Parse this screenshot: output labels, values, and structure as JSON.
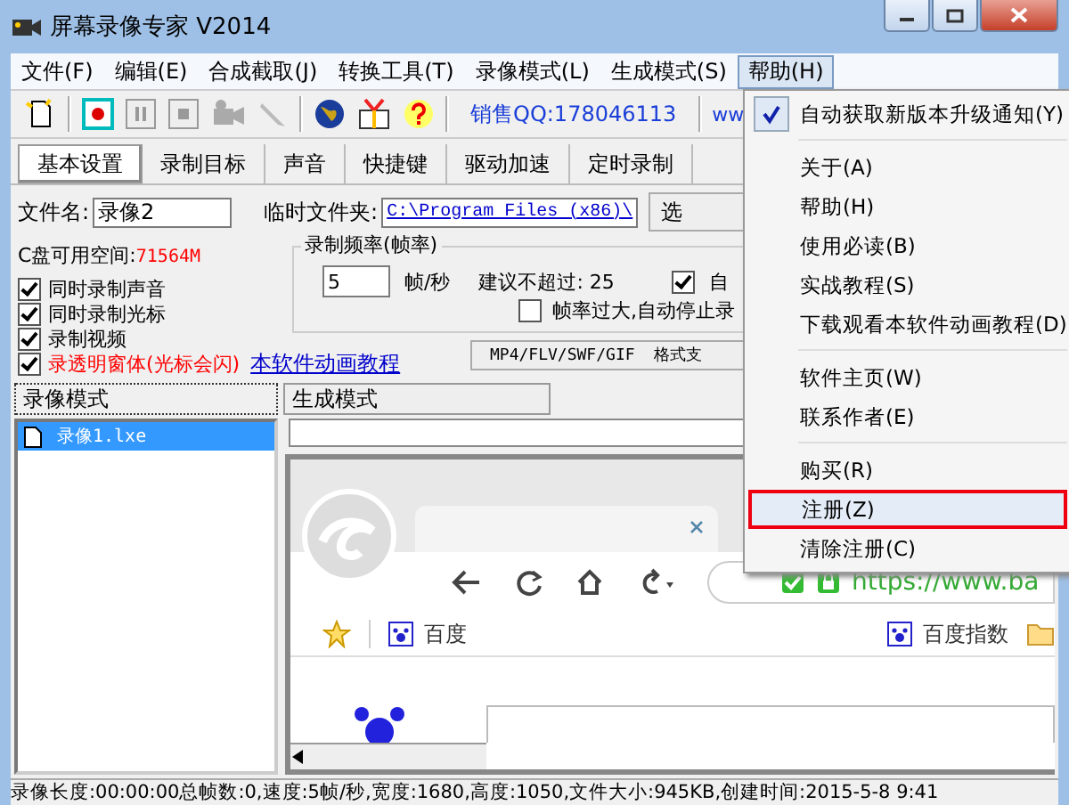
{
  "window": {
    "title": "屏幕录像专家 V2014"
  },
  "menu_bar": [
    {
      "label": "文件(F)",
      "selected": false
    },
    {
      "label": "编辑(E)",
      "selected": false
    },
    {
      "label": "合成截取(J)",
      "selected": false
    },
    {
      "label": "转换工具(T)",
      "selected": false
    },
    {
      "label": "录像模式(L)",
      "selected": false
    },
    {
      "label": "生成模式(S)",
      "selected": false
    },
    {
      "label": "帮助(H)",
      "selected": true
    }
  ],
  "toolbar": {
    "sales_qq": "销售QQ:178046113",
    "website": "ww"
  },
  "tabs": [
    {
      "label": "基本设置",
      "selected": true
    },
    {
      "label": "录制目标",
      "selected": false
    },
    {
      "label": "声音",
      "selected": false
    },
    {
      "label": "快捷键",
      "selected": false
    },
    {
      "label": "驱动加速",
      "selected": false
    },
    {
      "label": "定时录制",
      "selected": false
    }
  ],
  "settings": {
    "file_name_label": "文件名:",
    "file_name": "录像2",
    "temp_folder_label": "临时文件夹:",
    "temp_folder": "C:\\Program Files (x86)\\",
    "browse_button": "选",
    "disk_space_label": "C盘可用空间:",
    "disk_space": "71564M",
    "options": [
      {
        "label": "同时录制声音",
        "checked": true,
        "kind": "normal"
      },
      {
        "label": "同时录制光标",
        "checked": true,
        "kind": "normal"
      },
      {
        "label": "录制视频",
        "checked": true,
        "kind": "normal"
      },
      {
        "label": "录透明窗体(光标会闪)",
        "checked": true,
        "kind": "warning"
      }
    ],
    "tutorial_link": "本软件动画教程",
    "format_button": "MP4/FLV/SWF/GIF  格式支"
  },
  "frame_rate": {
    "title": "录制频率(帧率)",
    "value": "5",
    "unit": "帧/秒",
    "hint": "建议不超过: 25",
    "auto_option": {
      "label": "自",
      "checked": true
    },
    "auto_stop": {
      "label": "帧率过大,自动停止录",
      "checked": false
    }
  },
  "mode_tabs": [
    {
      "label": "录像模式",
      "selected": true
    },
    {
      "label": "生成模式",
      "selected": false
    }
  ],
  "files": [
    {
      "name": "录像1.lxe",
      "selected": true
    }
  ],
  "preview": {
    "address": "https://www.ba",
    "bookmarks": [
      "百度",
      "百度指数"
    ]
  },
  "help_menu": [
    {
      "kind": "check",
      "label": "自动获取新版本升级通知(Y)",
      "checked": true
    },
    {
      "kind": "separator"
    },
    {
      "kind": "item",
      "label": "关于(A)",
      "selected": false
    },
    {
      "kind": "item",
      "label": "帮助(H)",
      "selected": false
    },
    {
      "kind": "item",
      "label": "使用必读(B)",
      "selected": false
    },
    {
      "kind": "item",
      "label": "实战教程(S)",
      "selected": false
    },
    {
      "kind": "item",
      "label": "下载观看本软件动画教程(D)",
      "selected": false
    },
    {
      "kind": "separator"
    },
    {
      "kind": "item",
      "label": "软件主页(W)",
      "selected": false
    },
    {
      "kind": "item",
      "label": "联系作者(E)",
      "selected": false
    },
    {
      "kind": "separator"
    },
    {
      "kind": "item",
      "label": "购买(R)",
      "selected": false
    },
    {
      "kind": "item",
      "label": "注册(Z)",
      "selected": true
    },
    {
      "kind": "item",
      "label": "清除注册(C)",
      "selected": false
    }
  ],
  "status_bar": "录像长度:00:00:00总帧数:0,速度:5帧/秒,宽度:1680,高度:1050,文件大小:945KB,创建时间:2015-5-8 9:41"
}
